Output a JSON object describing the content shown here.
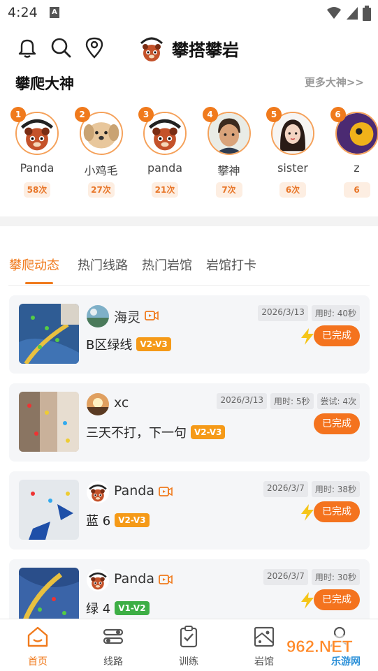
{
  "status_bar": {
    "time": "4:24",
    "notif_icon": "A"
  },
  "header": {
    "app_title": "攀搭攀岩"
  },
  "champions_section": {
    "title": "攀爬大神",
    "more_label": "更多大神>>",
    "items": [
      {
        "rank": "1",
        "name": "Panda",
        "count": "58次",
        "avatar": "panda-logo"
      },
      {
        "rank": "2",
        "name": "小鸡毛",
        "count": "27次",
        "avatar": "dog"
      },
      {
        "rank": "3",
        "name": "panda",
        "count": "21次",
        "avatar": "panda-logo"
      },
      {
        "rank": "4",
        "name": "攀神",
        "count": "7次",
        "avatar": "boy"
      },
      {
        "rank": "5",
        "name": "sister",
        "count": "6次",
        "avatar": "girl"
      },
      {
        "rank": "6",
        "name": "z",
        "count": "6",
        "avatar": "purple"
      }
    ]
  },
  "tabs": [
    "攀爬动态",
    "热门线路",
    "热门岩馆",
    "岩馆打卡"
  ],
  "feed": [
    {
      "user": "海灵",
      "route": "B区绿线",
      "grade": "V2-V3",
      "grade_color": "orange",
      "date": "2026/3/13",
      "time_used": "用时: 40秒",
      "attempts": "",
      "status": "已完成",
      "video": true,
      "bolt": true,
      "avatar": "sea"
    },
    {
      "user": "xc",
      "route": "三天不打，下一句",
      "grade": "V2-V3",
      "grade_color": "orange",
      "date": "2026/3/13",
      "time_used": "用时: 5秒",
      "attempts": "尝试: 4次",
      "status": "已完成",
      "video": false,
      "bolt": false,
      "avatar": "sunset"
    },
    {
      "user": "Panda",
      "route": "蓝 6",
      "grade": "V2-V3",
      "grade_color": "orange",
      "date": "2026/3/7",
      "time_used": "用时: 38秒",
      "attempts": "",
      "status": "已完成",
      "video": true,
      "bolt": true,
      "avatar": "panda-logo"
    },
    {
      "user": "Panda",
      "route": "绿 4",
      "grade": "V1-V2",
      "grade_color": "green",
      "date": "2026/3/7",
      "time_used": "用时: 30秒",
      "attempts": "",
      "status": "已完成",
      "video": true,
      "bolt": true,
      "avatar": "panda-logo"
    }
  ],
  "bottom_nav": [
    {
      "label": "首页",
      "icon": "home-icon",
      "active": true
    },
    {
      "label": "线路",
      "icon": "route-icon",
      "active": false
    },
    {
      "label": "训练",
      "icon": "clipboard-check-icon",
      "active": false
    },
    {
      "label": "岩馆",
      "icon": "gym-map-icon",
      "active": false
    },
    {
      "label": "",
      "icon": "person-icon",
      "active": false
    }
  ],
  "watermark": {
    "text": "962.NET",
    "subtext": "乐游网"
  },
  "colors": {
    "accent": "#f07a1c",
    "done_button": "#f4731e",
    "grade_orange": "#f59a18",
    "grade_green": "#3dae45"
  }
}
